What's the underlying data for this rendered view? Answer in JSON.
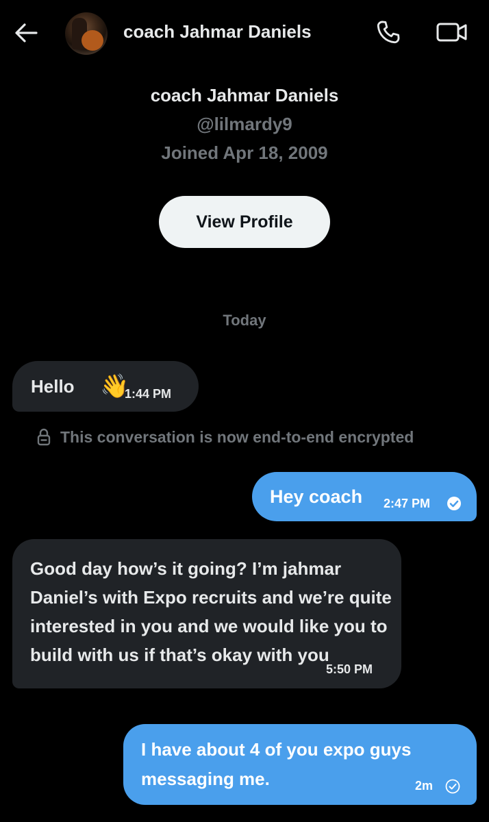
{
  "header": {
    "name": "coach Jahmar Daniels",
    "back_icon": "arrow-left-icon",
    "call_icon": "phone-icon",
    "video_icon": "video-camera-icon"
  },
  "profile": {
    "name": "coach Jahmar Daniels",
    "handle": "@lilmardy9",
    "joined": "Joined Apr 18, 2009",
    "view_profile_label": "View Profile"
  },
  "conversation": {
    "day_separator": "Today",
    "encryption_notice": "This conversation is now end-to-end encrypted",
    "messages": [
      {
        "direction": "incoming",
        "text": "Hello",
        "emoji": "👋",
        "time": "1:44 PM"
      },
      {
        "direction": "outgoing",
        "text": "Hey coach",
        "time": "2:47 PM",
        "status_icon": "read-check-icon"
      },
      {
        "direction": "incoming",
        "text": "Good day how’s it going? I’m jahmar Daniel’s with Expo recruits and we’re quite interested in you and we would like you to build with us if that’s okay with you",
        "time": "5:50 PM"
      },
      {
        "direction": "outgoing",
        "text": "I have about 4 of you expo guys messaging me.",
        "time": "2m",
        "status_icon": "sent-check-icon"
      }
    ]
  },
  "colors": {
    "background": "#000000",
    "incoming_bubble": "#202327",
    "outgoing_bubble": "#4a9fec",
    "secondary_text": "#71767b",
    "button_bg": "#eff3f4"
  }
}
